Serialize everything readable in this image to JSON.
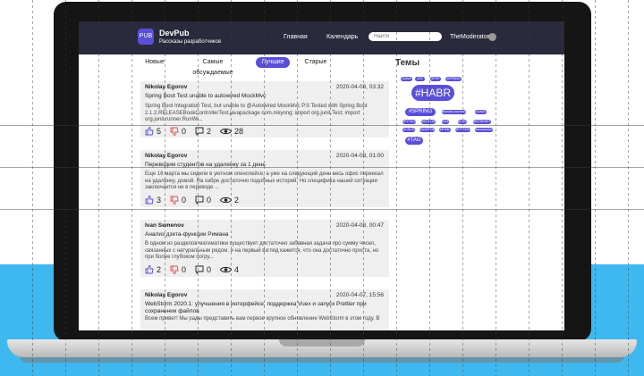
{
  "header": {
    "logo_text": "PUB",
    "brand": "DevPub",
    "tagline": "Рассказы разработчиков",
    "nav": [
      "Главная",
      "Календарь"
    ],
    "search_placeholder": "Найти",
    "username": "TheModerator"
  },
  "tabs": [
    "Новые",
    "Самые обсуждаемые",
    "Лучшие",
    "Старые"
  ],
  "active_tab": "Лучшие",
  "posts": [
    {
      "author": "Nikolay Egorov",
      "date": "2020-04-08, 03:32",
      "title": "Spring Boot Test unable to autowired MockMvc",
      "excerpt": "Spring Boot Integration Test, but unable to @Autowired MockMvc P.S Tested with Spring Boot 2.1.2.RELEASEBookControllerTest.javapackage com.mkyong; import org.junit.Test; import org.junit.runner.RunWi...",
      "likes": "5",
      "dislikes": "0",
      "comments": "2",
      "views": "28"
    },
    {
      "author": "Nikolay Egorov",
      "date": "2020-04-08, 01:00",
      "title": "Переводим студентов на удаленку за 1 день",
      "excerpt": "Еще 16 марта мы сидели в уютном опенспейсе, а уже на следующий день весь офис переехал на удаленку, домой. На хабре достаточно подобных историй. Но специфика нашей ситуации заключается не в переводе ...",
      "likes": "3",
      "dislikes": "0",
      "comments": "0",
      "views": "2"
    },
    {
      "author": "Ivan Semenov",
      "date": "2020-04-08, 00:47",
      "title": "Анализ дзета-функции Римана",
      "excerpt": "В одном из разделов математики существует достаточно забавная задача про сумму чисел, связанных с натуральным рядом, и на первый взгляд кажется, что она достаточно проста, но при более глубоком погру...",
      "likes": "2",
      "dislikes": "0",
      "comments": "0",
      "views": "4"
    },
    {
      "author": "Nikolay Egorov",
      "date": "2020-04-07, 15:56",
      "title": "WebStorm 2020.1: улучшения в интерфейсе, поддержка Vuex и запуск Prettier при сохранении файлов",
      "excerpt": "Всем привет! Мы рады представить вам первое крупное обновление WebStorm в этом году. В"
    }
  ],
  "tags_title": "Темы",
  "tags": [
    "#JAVA",
    "#JS",
    "#PHP",
    "#SPRING",
    "#HABR",
    "#SPRING",
    "#BAMBA-RHUMBA",
    "#JAVA",
    "#PYTHON",
    "#KOTLIN",
    "#C#",
    "#CSS",
    "#INTERNET",
    "#LINUX",
    "#ANDROID",
    "#HTML",
    "#PYTHON",
    "#MATEMATIK",
    "#TAG"
  ],
  "colors": {
    "accent": "#5a4fd8",
    "header_bg": "#2a2a3d",
    "dislike": "#e04a4a"
  }
}
